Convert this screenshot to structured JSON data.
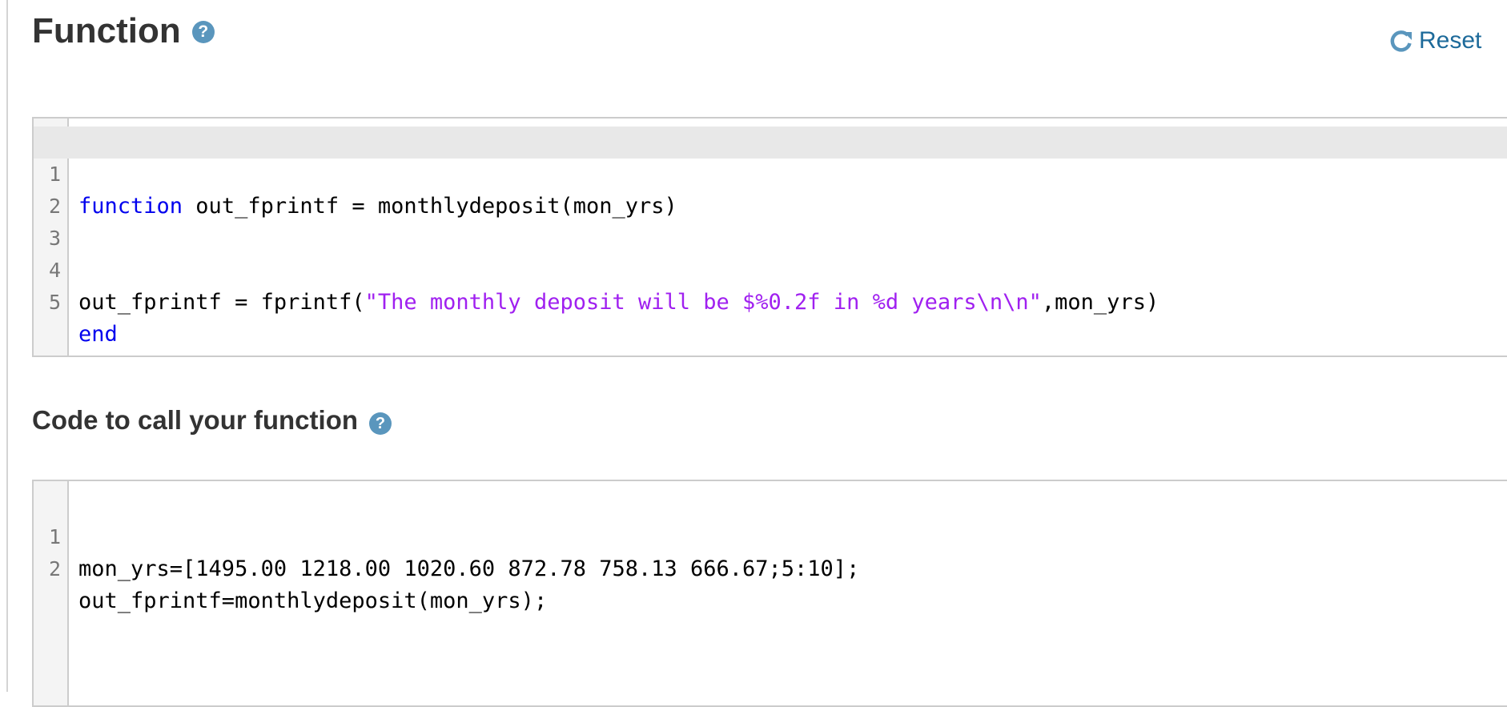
{
  "function_section": {
    "title": "Function",
    "help_icon": "?",
    "reset_label": "Reset",
    "editor": {
      "lines": [
        {
          "num": "1",
          "kw1": "function",
          "rest": " out_fprintf = monthlydeposit(mon_yrs)"
        },
        {
          "num": "2",
          "code": ""
        },
        {
          "num": "3",
          "code": ""
        },
        {
          "num": "4",
          "pre": "out_fprintf = fprintf(",
          "str": "\"The monthly deposit will be $%0.2f in %d years\\n\\n\"",
          "post": ",mon_yrs)"
        },
        {
          "num": "5",
          "kw1": "end",
          "rest": ""
        }
      ]
    }
  },
  "call_section": {
    "title": "Code to call your function",
    "help_icon": "?",
    "editor": {
      "lines": [
        {
          "num": "1",
          "code": "mon_yrs=[1495.00 1218.00 1020.60 872.78 758.13 666.67;5:10];"
        },
        {
          "num": "2",
          "code": "out_fprintf=monthlydeposit(mon_yrs);"
        }
      ]
    }
  },
  "colors": {
    "keyword": "#0000ee",
    "string": "#a020f0",
    "link": "#1d6a9a",
    "help_icon_bg": "#5a96bd"
  }
}
